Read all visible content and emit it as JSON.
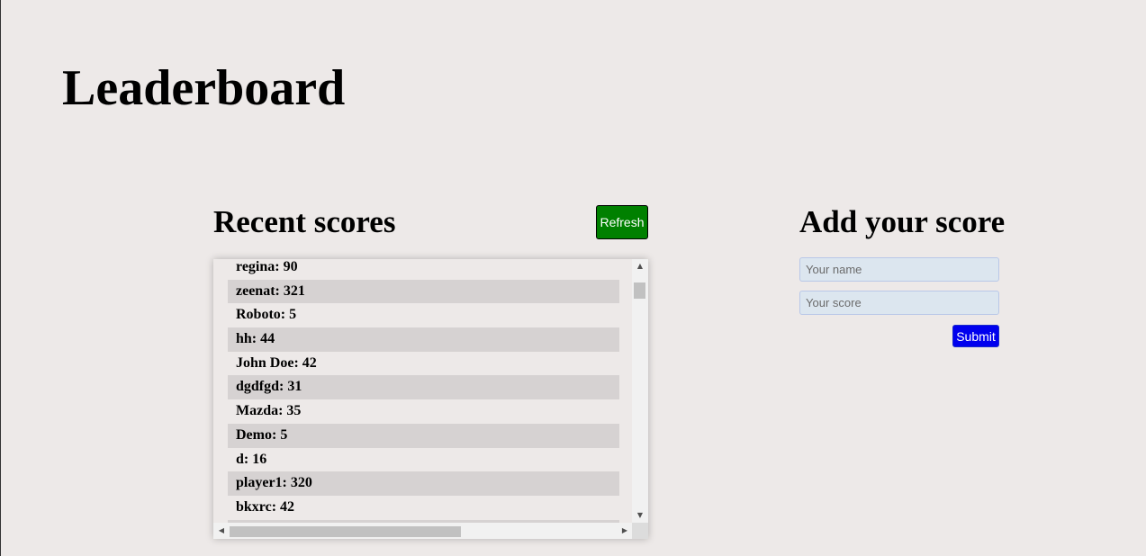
{
  "page": {
    "title": "Leaderboard"
  },
  "recent": {
    "title": "Recent scores",
    "refresh_label": "Refresh",
    "refresh_color": "#008000",
    "scores": [
      {
        "label": "regina: 90"
      },
      {
        "label": "zeenat: 321"
      },
      {
        "label": "Roboto: 5"
      },
      {
        "label": "hh: 44"
      },
      {
        "label": "John Doe: 42"
      },
      {
        "label": "dgdfgd: 31"
      },
      {
        "label": "Mazda: 35"
      },
      {
        "label": "Demo: 5"
      },
      {
        "label": "d: 16"
      },
      {
        "label": "player1: 320"
      },
      {
        "label": "bkxrc: 42"
      }
    ]
  },
  "add": {
    "title": "Add your score",
    "name_placeholder": "Your name",
    "score_placeholder": "Your score",
    "submit_label": "Submit",
    "submit_color": "#0000ee"
  }
}
